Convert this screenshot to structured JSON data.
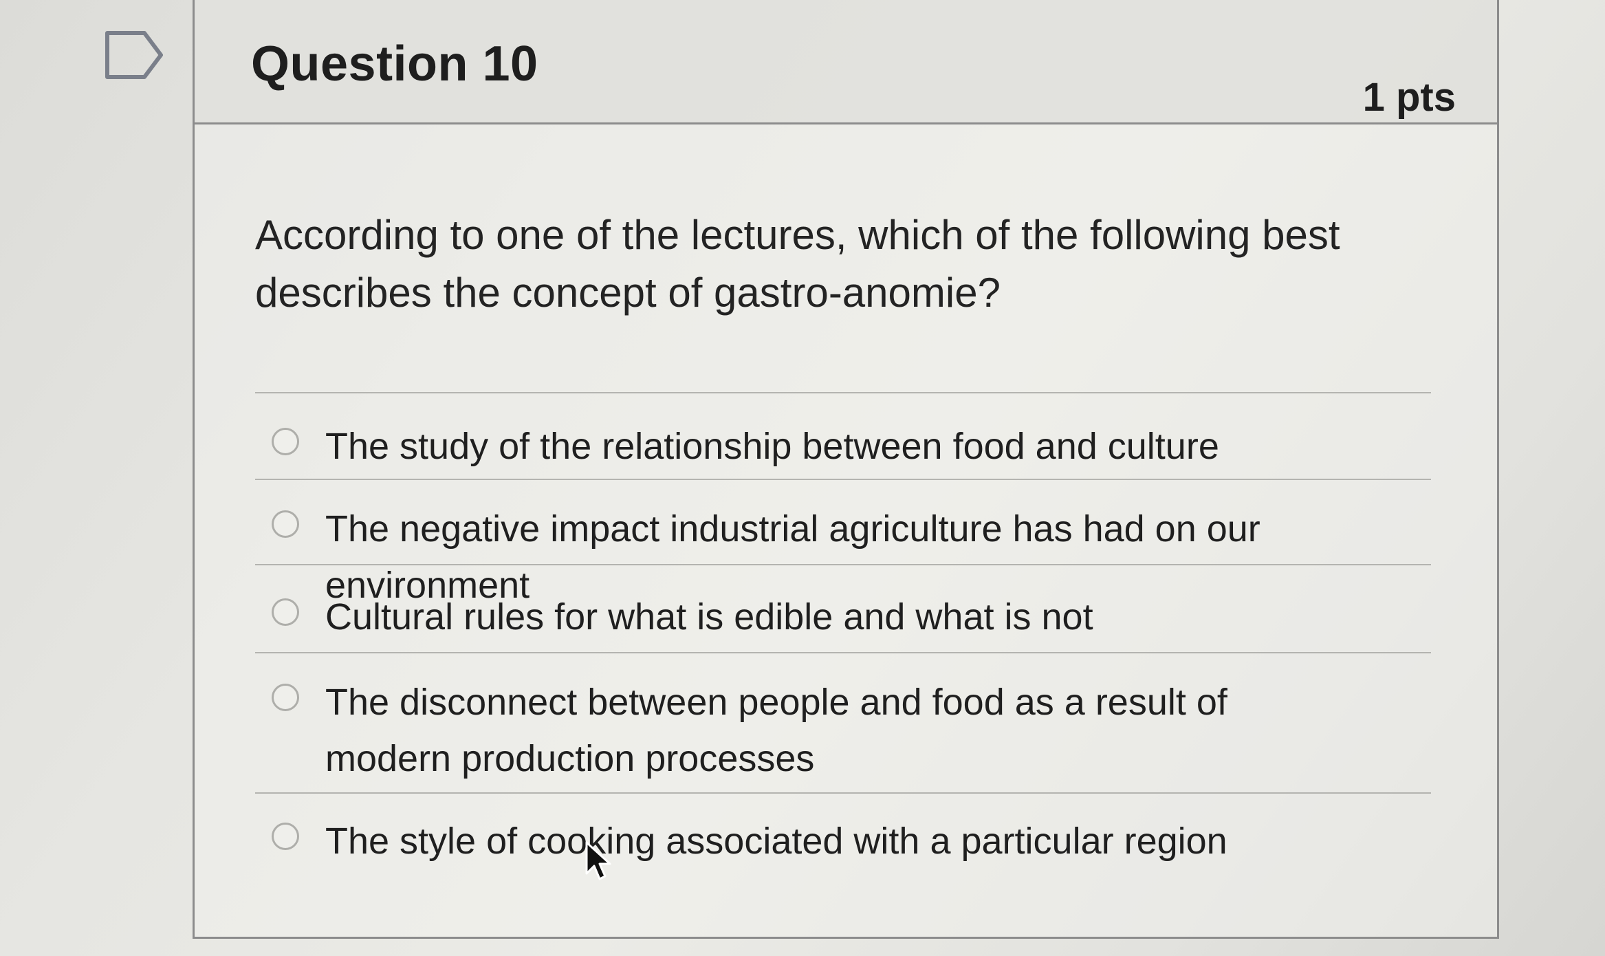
{
  "question": {
    "title": "Question 10",
    "points": "1 pts",
    "text": "According to one of the lectures, which of the following best describes the concept of gastro-anomie?",
    "flag_icon": "flag-icon",
    "answers": [
      {
        "label": "The study of the relationship between food and culture"
      },
      {
        "label": "The negative impact industrial agriculture has had on our environment"
      },
      {
        "label": "Cultural rules for what is edible and what is not"
      },
      {
        "label": "The disconnect between people and food as a result of modern production processes"
      },
      {
        "label": "The style of cooking associated with a particular region"
      }
    ]
  },
  "colors": {
    "border": "#8c8c8c",
    "text": "#1e1e1e",
    "radio_border": "#aeaeaa"
  }
}
